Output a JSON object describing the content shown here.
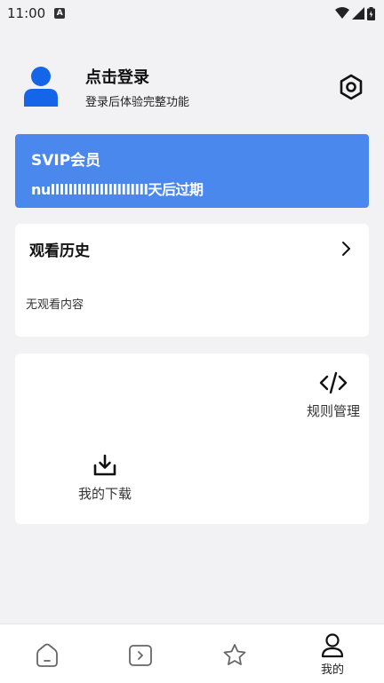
{
  "status_bar": {
    "time": "11:00",
    "badge": "A"
  },
  "profile": {
    "title": "点击登录",
    "subtitle": "登录后体验完整功能",
    "avatar_icon": "person-icon",
    "settings_icon": "settings-hexagon-icon"
  },
  "vip": {
    "title": "SVIP会员",
    "expiry": "nullllllllllllllllllllll天后过期",
    "background": "#4a88ee"
  },
  "history": {
    "title": "观看历史",
    "empty_text": "无观看内容",
    "chevron_icon": "chevron-right-icon"
  },
  "tools": {
    "rules_label": "规则管理",
    "rules_icon": "code-icon",
    "download_label": "我的下载",
    "download_icon": "download-icon"
  },
  "bottom_nav": {
    "active_label": "我的",
    "items": [
      "home-icon",
      "play-icon",
      "star-icon",
      "person-icon"
    ]
  }
}
